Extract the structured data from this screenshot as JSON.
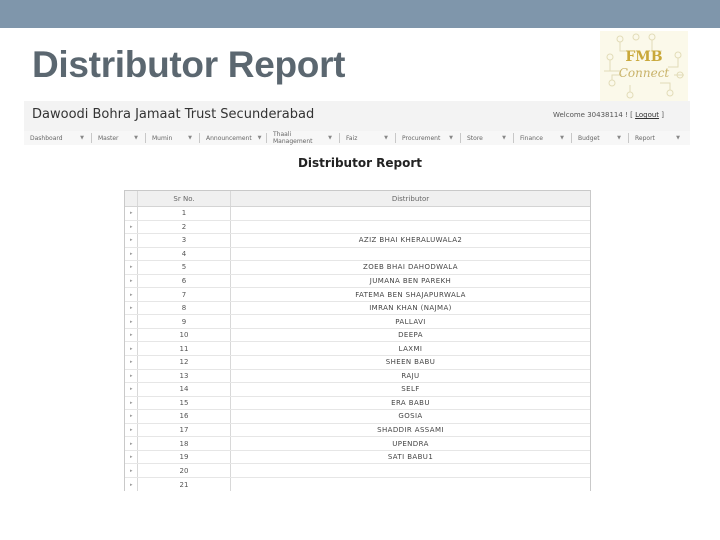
{
  "slide": {
    "title": "Distributor Report",
    "logo": {
      "line1": "FMB",
      "line2": "Connect"
    }
  },
  "app": {
    "name": "Dawoodi Bohra Jamaat Trust Secunderabad",
    "welcome_prefix": "Welcome 30438114 ! [ ",
    "logout_label": "Logout",
    "welcome_suffix": " ]"
  },
  "nav": {
    "items": [
      {
        "label": "Dashboard"
      },
      {
        "label": "Master"
      },
      {
        "label": "Mumin"
      },
      {
        "label": "Announcement"
      },
      {
        "label": "Thaali Management"
      },
      {
        "label": "Faiz"
      },
      {
        "label": "Procurement"
      },
      {
        "label": "Store"
      },
      {
        "label": "Finance"
      },
      {
        "label": "Budget"
      },
      {
        "label": "Report"
      }
    ],
    "caret_icon": "▼"
  },
  "report": {
    "heading": "Distributor Report",
    "columns": [
      "",
      "Sr No.",
      "Distributor"
    ],
    "expander_icon": "▸",
    "rows": [
      {
        "sr": "1",
        "distributor": ""
      },
      {
        "sr": "2",
        "distributor": ""
      },
      {
        "sr": "3",
        "distributor": "AZIZ BHAI KHERALUWALA2"
      },
      {
        "sr": "4",
        "distributor": ""
      },
      {
        "sr": "5",
        "distributor": "ZOEB BHAI DAHODWALA"
      },
      {
        "sr": "6",
        "distributor": "JUMANA BEN PAREKH"
      },
      {
        "sr": "7",
        "distributor": "FATEMA BEN SHAJAPURWALA"
      },
      {
        "sr": "8",
        "distributor": "IMRAN KHAN (NAJMA)"
      },
      {
        "sr": "9",
        "distributor": "PALLAVI"
      },
      {
        "sr": "10",
        "distributor": "DEEPA"
      },
      {
        "sr": "11",
        "distributor": "LAXMI"
      },
      {
        "sr": "12",
        "distributor": "SHEEN BABU"
      },
      {
        "sr": "13",
        "distributor": "RAJU"
      },
      {
        "sr": "14",
        "distributor": "SELF"
      },
      {
        "sr": "15",
        "distributor": "ERA BABU"
      },
      {
        "sr": "16",
        "distributor": "GOSIA"
      },
      {
        "sr": "17",
        "distributor": "SHADDIR ASSAMI"
      },
      {
        "sr": "18",
        "distributor": "UPENDRA"
      },
      {
        "sr": "19",
        "distributor": "SATI BABU1"
      },
      {
        "sr": "20",
        "distributor": ""
      },
      {
        "sr": "21",
        "distributor": ""
      }
    ]
  },
  "colors": {
    "top_band": "#7f96ab",
    "title_text": "#5b6770",
    "logo_gold": "#c9a83a"
  }
}
